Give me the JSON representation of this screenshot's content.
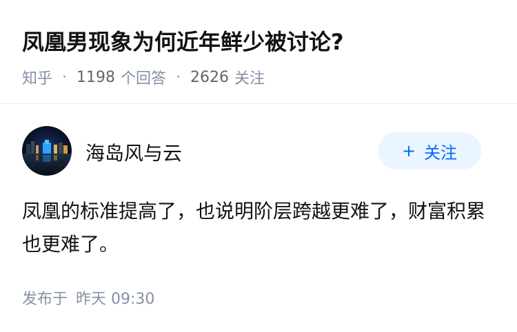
{
  "question": {
    "title": "凤凰男现象为何近年鲜少被讨论?",
    "source": "知乎",
    "answers_count": "1198",
    "answers_label": "个回答",
    "followers_count": "2626",
    "followers_label": "关注"
  },
  "answer": {
    "author_name": "海岛风与云",
    "follow_label": "关注",
    "follow_icon": "plus-icon",
    "content": "凤凰的标准提高了，也说明阶层跨越更难了，财富积累也更难了。",
    "published_label": "发布于",
    "published_time": "昨天 09:30"
  },
  "colors": {
    "meta_gray": "#8590a6",
    "brand_blue": "#0066ff",
    "follow_bg": "#ebf5ff"
  }
}
